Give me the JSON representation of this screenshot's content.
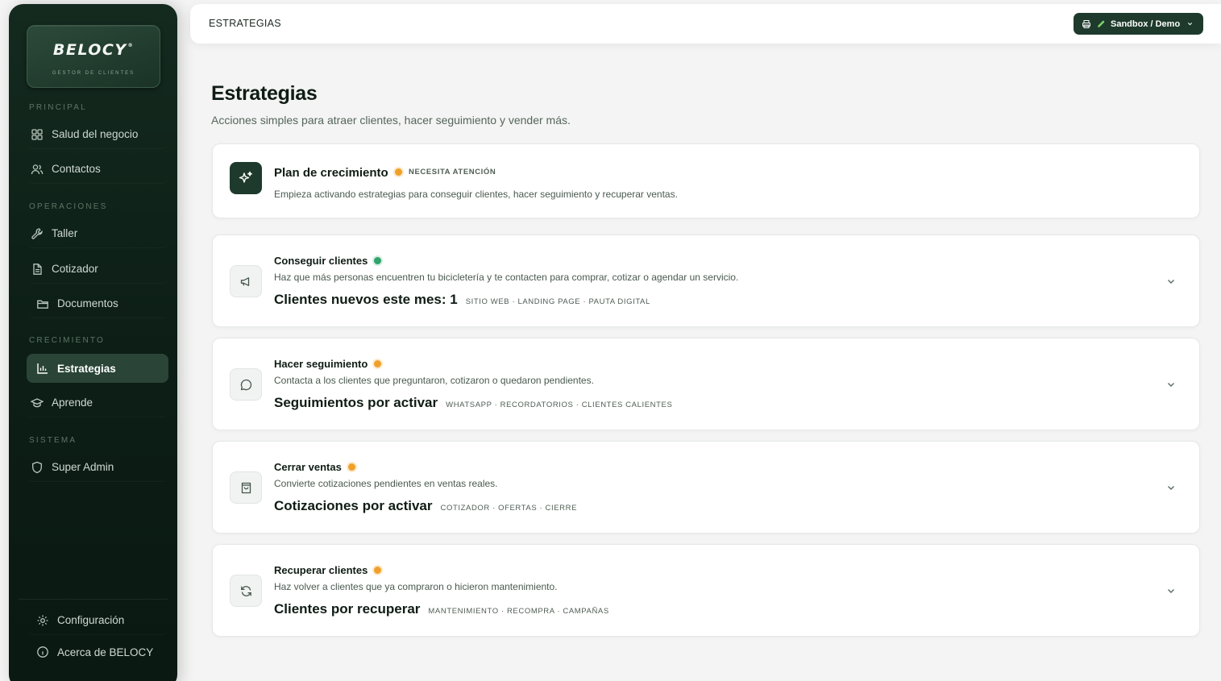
{
  "brand": {
    "name": "BELOCY",
    "mark": "®",
    "tagline": "GESTOR DE CLIENTES"
  },
  "sidebar": {
    "sections": {
      "principal": "PRINCIPAL",
      "operaciones": "OPERACIONES",
      "crecimiento": "CRECIMIENTO",
      "sistema": "SISTEMA"
    },
    "items": {
      "salud": "Salud del negocio",
      "contactos": "Contactos",
      "taller": "Taller",
      "cotizador": "Cotizador",
      "documentos": "Documentos",
      "estrategias": "Estrategias",
      "aprende": "Aprende",
      "superadmin": "Super Admin"
    },
    "footer": {
      "config": "Configuración",
      "about": "Acerca de BELOCY"
    },
    "active_item": "Estrategias"
  },
  "topbar": {
    "title": "ESTRATEGIAS",
    "environment": "Sandbox / Demo"
  },
  "main": {
    "title": "Estrategias",
    "subtitle": "Acciones simples para atraer clientes, hacer seguimiento y vender más.",
    "plan": {
      "title": "Plan de crecimiento",
      "status": "NECESITA ATENCIÓN",
      "description": "Empieza activando estrategias para conseguir clientes, hacer seguimiento y recuperar ventas."
    },
    "strategies": [
      {
        "title": "Conseguir clientes",
        "status_color": "green",
        "description": "Haz que más personas encuentren tu bicicletería y te contacten para comprar, cotizar o agendar un servicio.",
        "metric": "Clientes nuevos este mes: 1",
        "tags": "SITIO WEB · LANDING PAGE · PAUTA DIGITAL",
        "icon": "megaphone-icon"
      },
      {
        "title": "Hacer seguimiento",
        "status_color": "orange",
        "description": "Contacta a los clientes que preguntaron, cotizaron o quedaron pendientes.",
        "metric": "Seguimientos por activar",
        "tags": "WHATSAPP · RECORDATORIOS · CLIENTES CALIENTES",
        "icon": "chat-bubble-icon"
      },
      {
        "title": "Cerrar ventas",
        "status_color": "orange",
        "description": "Convierte cotizaciones pendientes en ventas reales.",
        "metric": "Cotizaciones por activar",
        "tags": "COTIZADOR · OFERTAS · CIERRE",
        "icon": "shopping-bag-icon"
      },
      {
        "title": "Recuperar clientes",
        "status_color": "orange",
        "description": "Haz volver a clientes que ya compraron o hicieron mantenimiento.",
        "metric": "Clientes por recuperar",
        "tags": "MANTENIMIENTO · RECOMPRA · CAMPAÑAS",
        "icon": "refresh-icon"
      }
    ]
  },
  "colors": {
    "sidebar_bg": "#0d1f17",
    "accent": "#1e3a2c",
    "warning": "#f0a02a",
    "success": "#2fa36b"
  }
}
